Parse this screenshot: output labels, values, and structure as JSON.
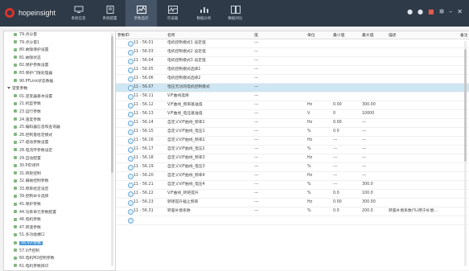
{
  "app": {
    "brand": "hopeinsight"
  },
  "nav": [
    {
      "label": "系统信息"
    },
    {
      "label": "系统配置"
    },
    {
      "label": "参数监控",
      "active": true
    },
    {
      "label": "示波器"
    },
    {
      "label": "数据分析"
    },
    {
      "label": "数据对比"
    }
  ],
  "tree": [
    {
      "label": "79.点分量",
      "type": "leaf"
    },
    {
      "label": "79.点分量1",
      "type": "leaf"
    },
    {
      "label": "80.故障保护设置",
      "type": "leaf"
    },
    {
      "label": "81.故障状态",
      "type": "leaf"
    },
    {
      "label": "82.保护参数设置",
      "type": "leaf"
    },
    {
      "label": "83.保护门限处理器",
      "type": "leaf"
    },
    {
      "label": "90.PFLink状态数据",
      "type": "leaf"
    },
    {
      "label": "逆变参数",
      "type": "group"
    },
    {
      "label": "01.逆变器基本设置",
      "type": "leaf"
    },
    {
      "label": "21.机型参数",
      "type": "leaf"
    },
    {
      "label": "23.运行参数",
      "type": "leaf"
    },
    {
      "label": "24.速度参数",
      "type": "leaf"
    },
    {
      "label": "25.编码器信息和查询器",
      "type": "leaf"
    },
    {
      "label": "26.控制量给定模式",
      "type": "leaf"
    },
    {
      "label": "27.驱动参数设置",
      "type": "leaf"
    },
    {
      "label": "28.电流环参数设定",
      "type": "leaf"
    },
    {
      "label": "29.自动配置",
      "type": "leaf"
    },
    {
      "label": "30.PID闭环",
      "type": "leaf"
    },
    {
      "label": "31.转矩控制",
      "type": "leaf"
    },
    {
      "label": "32.弱磁控制参数",
      "type": "leaf"
    },
    {
      "label": "33.频率给定设定",
      "type": "leaf"
    },
    {
      "label": "39.控制命令选择",
      "type": "leaf"
    },
    {
      "label": "41.保护参数",
      "type": "leaf"
    },
    {
      "label": "44.功率单元参数配置",
      "type": "leaf"
    },
    {
      "label": "46.电机参数",
      "type": "leaf"
    },
    {
      "label": "47.转速参数",
      "type": "leaf"
    },
    {
      "label": "51.多功能端口",
      "type": "leaf"
    },
    {
      "label": "56.V/F参数",
      "type": "leaf",
      "selected": true
    },
    {
      "label": "57.V/F控制",
      "type": "leaf"
    },
    {
      "label": "60.电机M2控制参数",
      "type": "leaf"
    },
    {
      "label": "61.电机参数辨识",
      "type": "leaf"
    }
  ],
  "table": {
    "headers": {
      "addr": "参数ID",
      "name": "名称",
      "value": "值",
      "unit": "单位",
      "min": "最小值",
      "max": "最大值",
      "desc": "描述",
      "note": "备注"
    },
    "rows": [
      {
        "addr": "11 - 56.01",
        "name": "电机控制模式1 设定值",
        "value": "---",
        "unit": "",
        "min": "",
        "max": "",
        "desc": ""
      },
      {
        "addr": "11 - 56.03",
        "name": "电机控制模式2 设定值",
        "value": "---",
        "unit": "",
        "min": "",
        "max": "",
        "desc": ""
      },
      {
        "addr": "11 - 56.04",
        "name": "电机控制模式3 设定值",
        "value": "---",
        "unit": "",
        "min": "",
        "max": "",
        "desc": ""
      },
      {
        "addr": "11 - 56.05",
        "name": "电机控制模式选择1",
        "value": "---",
        "unit": "",
        "min": "",
        "max": "",
        "desc": ""
      },
      {
        "addr": "11 - 56.06",
        "name": "电机控制模式选择2",
        "value": "---",
        "unit": "",
        "min": "",
        "max": "",
        "desc": ""
      },
      {
        "addr": "11 - 56.07",
        "name": "恒压无功的电机控制模式",
        "value": "---",
        "unit": "",
        "min": "",
        "max": "",
        "desc": "",
        "highlight": true
      },
      {
        "addr": "11 - 56.11",
        "name": "V/F曲线选择",
        "value": "---",
        "unit": "",
        "min": "",
        "max": "",
        "desc": ""
      },
      {
        "addr": "11 - 56.12",
        "name": "V/F曲线_频率基准值",
        "value": "---",
        "unit": "Hz",
        "min": "0.00",
        "max": "300.00",
        "desc": ""
      },
      {
        "addr": "11 - 56.13",
        "name": "V/F曲线_电压基准值",
        "value": "---",
        "unit": "V",
        "min": "0",
        "max": "10000",
        "desc": ""
      },
      {
        "addr": "11 - 56.14",
        "name": "自定义V/F曲线_频率1",
        "value": "---",
        "unit": "Hz",
        "min": "0.00",
        "max": "---",
        "desc": ""
      },
      {
        "addr": "11 - 56.15",
        "name": "自定义V/F曲线_电压1",
        "value": "---",
        "unit": "%",
        "min": "0.0",
        "max": "---",
        "desc": ""
      },
      {
        "addr": "11 - 56.16",
        "name": "自定义V/F曲线_频率2",
        "value": "---",
        "unit": "Hz",
        "min": "---",
        "max": "---",
        "desc": ""
      },
      {
        "addr": "11 - 56.17",
        "name": "自定义V/F曲线_电压2",
        "value": "---",
        "unit": "%",
        "min": "---",
        "max": "---",
        "desc": ""
      },
      {
        "addr": "11 - 56.18",
        "name": "自定义V/F曲线_频率3",
        "value": "---",
        "unit": "Hz",
        "min": "---",
        "max": "---",
        "desc": ""
      },
      {
        "addr": "11 - 56.19",
        "name": "自定义V/F曲线_电压3",
        "value": "---",
        "unit": "%",
        "min": "---",
        "max": "---",
        "desc": ""
      },
      {
        "addr": "11 - 56.20",
        "name": "自定义V/F曲线_频率4",
        "value": "---",
        "unit": "Hz",
        "min": "---",
        "max": "---",
        "desc": ""
      },
      {
        "addr": "11 - 56.21",
        "name": "自定义V/F曲线_电压4",
        "value": "---",
        "unit": "%",
        "min": "---",
        "max": "300.0",
        "desc": ""
      },
      {
        "addr": "11 - 56.22",
        "name": "V/F曲线_转矩提升",
        "value": "---",
        "unit": "%",
        "min": "0.0",
        "max": "100.0",
        "desc": ""
      },
      {
        "addr": "11 - 56.23",
        "name": "转矩提升截止频率",
        "value": "---",
        "unit": "Hz",
        "min": "0.00",
        "max": "300.00",
        "desc": ""
      },
      {
        "addr": "11 - 56.31",
        "name": "转差补偿系数",
        "value": "---",
        "unit": "%",
        "min": "0.0",
        "max": "200.0",
        "desc": "转差补偿系数(%)用于补偿..."
      },
      {
        "addr": "",
        "name": "",
        "value": "",
        "unit": "",
        "min": "",
        "max": "",
        "desc": ""
      }
    ]
  }
}
